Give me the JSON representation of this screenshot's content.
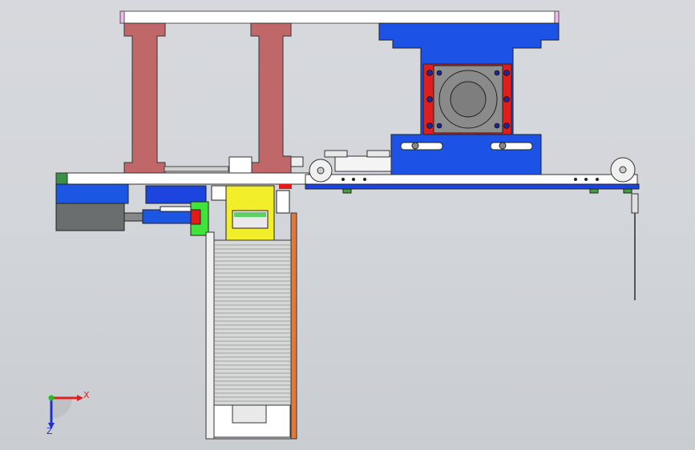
{
  "viewport": {
    "background_top": "#d6d8dd",
    "background_bottom": "#c9ccd1"
  },
  "model": {
    "colors": {
      "top_beam": "#ffffff",
      "pillar": "#c0676a",
      "motor_mount": "#1c53e6",
      "motor_plate": "#e01e1e",
      "motor_face": "#8f8f8f",
      "slide_plate": "#ffffff",
      "slide_rail": "#1c45e0",
      "gripper_body": "#f2ef2a",
      "green_block": "#3fe33a",
      "stack_magazine": "#d7d9d8",
      "side_strip": "#e07a3c",
      "servo_motor": "#6b6e6e",
      "servo_cover": "#1c57e3",
      "accent_red": "#e11a1a"
    }
  },
  "triad": {
    "x_label": "X",
    "y_label": "Z",
    "x_color": "#e02020",
    "y_color": "#2030d0",
    "origin_color": "#20c020"
  }
}
